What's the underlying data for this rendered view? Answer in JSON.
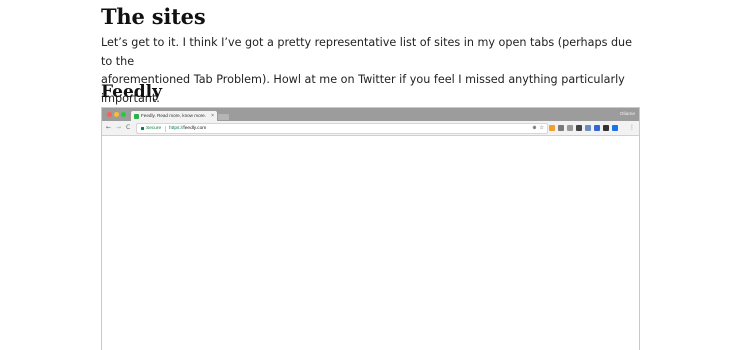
{
  "article": {
    "heading": "The sites",
    "intro_line1": "Let’s get to it. I think I’ve got a pretty representative list of sites in my open tabs (perhaps due to the",
    "intro_line2": "aforementioned Tab Problem). Howl at me on Twitter if you feel I missed anything particularly important.",
    "subheading": "Feedly"
  },
  "browser": {
    "tab_title": "Feedly. Read more, know more.",
    "tab_close": "×",
    "profile_name": "Oliame",
    "nav": {
      "back": "←",
      "forward": "→",
      "reload": "C"
    },
    "address": {
      "secure_label": "Secure",
      "scheme": "https://",
      "host": "feedly.com",
      "star_icon": "☆",
      "translate_icon": "⊕"
    },
    "menu_icon": "⋮",
    "extensions": [
      {
        "name": "ext-orange",
        "color": "#f0a030"
      },
      {
        "name": "ext-circle",
        "color": "#7a7a7a"
      },
      {
        "name": "ext-pen",
        "color": "#999999"
      },
      {
        "name": "ext-gear",
        "color": "#444444"
      },
      {
        "name": "ext-globe",
        "color": "#6c8ebf"
      },
      {
        "name": "ext-blue",
        "color": "#3367d6"
      },
      {
        "name": "ext-dark",
        "color": "#333333"
      },
      {
        "name": "ext-v",
        "color": "#1a73e8"
      }
    ]
  }
}
